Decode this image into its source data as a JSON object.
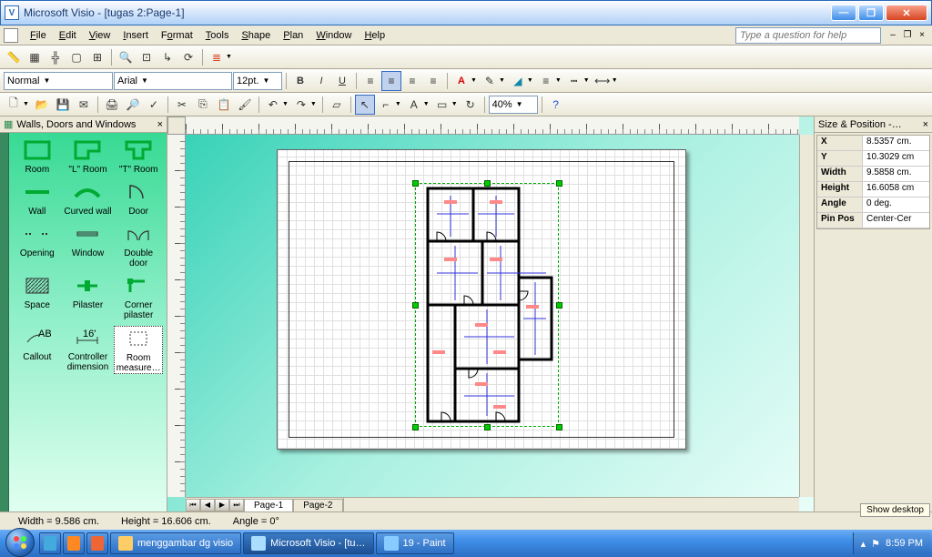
{
  "titlebar": {
    "title": "Microsoft Visio - [tugas 2:Page-1]"
  },
  "menus": {
    "file": "File",
    "edit": "Edit",
    "view": "View",
    "insert": "Insert",
    "format": "Format",
    "tools": "Tools",
    "shape": "Shape",
    "plan": "Plan",
    "window": "Window",
    "help": "Help",
    "help_placeholder": "Type a question for help"
  },
  "format_toolbar": {
    "style": "Normal",
    "font": "Arial",
    "size": "12pt.",
    "zoom": "40%"
  },
  "stencil": {
    "title": "Walls, Doors and Windows",
    "shapes": [
      "Room",
      "\"L\" Room",
      "\"T\" Room",
      "Wall",
      "Curved wall",
      "Door",
      "Opening",
      "Window",
      "Double door",
      "Space",
      "Pilaster",
      "Corner pilaster",
      "Callout",
      "Controller dimension",
      "Room measure…"
    ]
  },
  "pages": {
    "p1": "Page-1",
    "p2": "Page-2"
  },
  "size_position": {
    "title": "Size & Position -…",
    "rows": [
      {
        "k": "X",
        "v": "8.5357 cm."
      },
      {
        "k": "Y",
        "v": "10.3029 cm"
      },
      {
        "k": "Width",
        "v": "9.5858 cm."
      },
      {
        "k": "Height",
        "v": "16.6058 cm"
      },
      {
        "k": "Angle",
        "v": "0 deg."
      },
      {
        "k": "Pin Pos",
        "v": "Center-Cer"
      }
    ]
  },
  "statusbar": {
    "width": "Width = 9.586 cm.",
    "height": "Height = 16.606 cm.",
    "angle": "Angle = 0°"
  },
  "taskbar": {
    "items": [
      "menggambar dg visio",
      "Microsoft Visio - [tu…",
      "19 - Paint"
    ],
    "time": "8:59 PM",
    "showdesk": "Show desktop"
  }
}
